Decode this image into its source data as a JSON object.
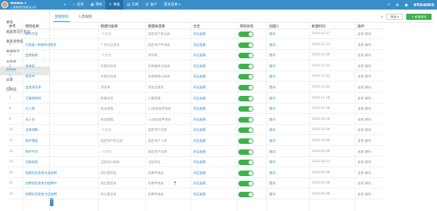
{
  "header": {
    "user_name": "momo ▾",
    "company": "上海商销专网科技公司",
    "nav": [
      {
        "icon": "⌂",
        "label": "",
        "name": "nav-home"
      },
      {
        "icon": "✓",
        "label": "任务",
        "name": "nav-task"
      },
      {
        "icon": "▦",
        "label": "项目",
        "name": "nav-project"
      },
      {
        "icon": "✎",
        "label": "审批",
        "name": "nav-approval"
      },
      {
        "icon": "▤",
        "label": "文档",
        "name": "nav-document"
      },
      {
        "icon": "☺",
        "label": "客户",
        "name": "nav-customer"
      },
      {
        "icon": "",
        "label": "更多应用 ▾",
        "name": "nav-more-apps"
      }
    ],
    "brand": "eteams"
  },
  "sidebar": {
    "items": [
      {
        "label": "审批",
        "arrow": "‹"
      },
      {
        "label": "审批意见历史记",
        "arrow": "‹"
      },
      {
        "label": "审批流管理",
        "arrow": "‹"
      },
      {
        "label": "审批统计",
        "arrow": "‹"
      },
      {
        "label": "云表单",
        "arrow": "‹"
      },
      {
        "label": "规则库",
        "arrow": ""
      },
      {
        "label": "设置",
        "arrow": ""
      },
      {
        "label": "回收站",
        "arrow": ""
      }
    ],
    "active_index": 5,
    "collapse_icon": "‹"
  },
  "toolbar": {
    "tabs": [
      "数据规则",
      "人员规则"
    ],
    "filter_label": "筛选 ▾",
    "new_label": "+ 新建规则"
  },
  "table": {
    "columns": [
      "序号",
      "规则名称",
      "数据归属表",
      "数据来源表",
      "日志",
      "规则状态",
      "创建人",
      "新建时间",
      "操作"
    ],
    "rows": [
      {
        "no": "1",
        "name": "库存不足",
        "owner": "*无数据",
        "source": "固定资产登记表",
        "log": "点击查看",
        "creator": "唐日",
        "date": "2020-02-27"
      },
      {
        "no": "2",
        "name": "已购里+到期时间变更",
        "owner": "广告位信息表",
        "source": "固定资产申请表",
        "log": "点击查看",
        "creator": "唐日",
        "date": "2019-12-13"
      },
      {
        "no": "3",
        "name": "自建规则",
        "owner": "*无数据",
        "source": "添车库",
        "log": "点击查看",
        "creator": "唐日",
        "date": "2019-12-09"
      },
      {
        "no": "4",
        "name": "待添车",
        "owner": "车辆信息表",
        "source": "车辆维修记录表",
        "log": "点击查看",
        "creator": "唐日",
        "date": "2019-12-03"
      },
      {
        "no": "5",
        "name": "添车中",
        "owner": "车辆信息表",
        "source": "车辆使用记录表",
        "log": "点击查看",
        "creator": "唐日",
        "date": "2019-12-03"
      },
      {
        "no": "6",
        "name": "自建添车单",
        "owner": "添车库",
        "source": "添车出库单",
        "log": "点击查看",
        "creator": "唐日",
        "date": "2019-12-03"
      },
      {
        "no": "7",
        "name": "订餐要规则",
        "owner": "套餐信息",
        "source": "订餐管理",
        "log": "点击查看",
        "creator": "唐日",
        "date": "2019-11-06"
      },
      {
        "no": "8",
        "name": "已入库",
        "owner": "宿舍管理",
        "source": "入/退宿舍申请表",
        "log": "点击查看",
        "creator": "唐日",
        "date": "2019-10-28"
      },
      {
        "no": "9",
        "name": "未入住",
        "owner": "宿舍管理",
        "source": "入/退宿舍申请表",
        "log": "点击查看",
        "creator": "唐日",
        "date": "2019-10-28"
      },
      {
        "no": "10",
        "name": "出库增数",
        "owner": "*无数据",
        "source": "固定资产出库",
        "log": "点击查看",
        "creator": "唐日",
        "date": "2019-10-09"
      },
      {
        "no": "11",
        "name": "库存增加",
        "owner": "固定资产登记表",
        "source": "固定资产入库",
        "log": "点击查看",
        "creator": "唐日",
        "date": "2019-10-09"
      },
      {
        "no": "12",
        "name": "库存不足",
        "owner": "*无数据",
        "source": "固定资产出库",
        "log": "点击查看",
        "creator": "唐日",
        "date": "2019-10-09"
      },
      {
        "no": "13",
        "name": "记账规则",
        "owner": "记账总分类账",
        "source": "记账凭证",
        "log": "点击查看",
        "creator": "唐日",
        "date": "2019-09-12"
      },
      {
        "no": "14",
        "name": "招聘状态变更为未招聘",
        "owner": "岗位需求表",
        "source": "招聘申请表",
        "log": "点击查看",
        "creator": "唐日",
        "date": "2019-05-06"
      },
      {
        "no": "15",
        "name": "招聘状态变更为招聘中",
        "owner": "岗位需求表",
        "source": "招聘申请表",
        "log": "点击查看",
        "creator": "唐日",
        "date": "2019-05-06"
      },
      {
        "no": "16",
        "name": "招聘状态变更为已招聘",
        "owner": "岗位需求表",
        "source": "招聘申请表",
        "log": "点击查看",
        "creator": "唐日",
        "date": "2019-05-06"
      }
    ],
    "ops": "查看 删除"
  },
  "colors": {
    "topbar": "#3a8ec9",
    "accent": "#3a8ec9",
    "toggle_on": "#3bb34a",
    "new_button": "#3bb34a"
  }
}
